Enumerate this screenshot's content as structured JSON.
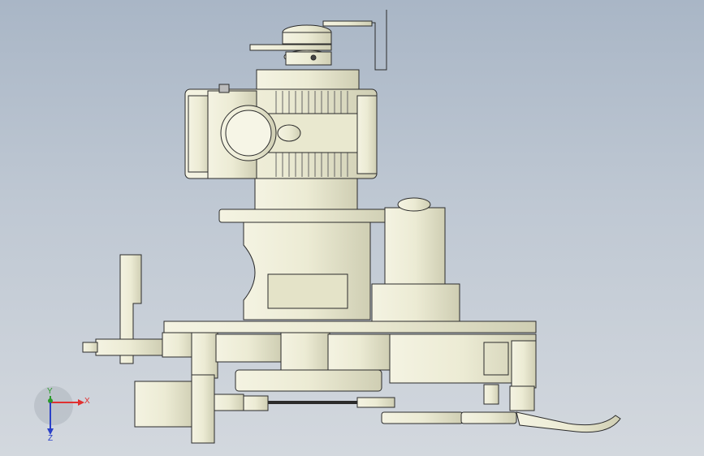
{
  "viewport": {
    "background": {
      "top": "#a9b6c6",
      "bottom": "#d3d8de"
    },
    "model_fill": "#ecebd4",
    "model_shade": "#d8d7bd",
    "model_stroke": "#2b2b2b"
  },
  "triad": {
    "x_label": "X",
    "y_label": "Y",
    "z_label": "Z",
    "x_color": "#e03030",
    "y_color": "#2a9a2a",
    "z_color": "#2a40c8"
  }
}
